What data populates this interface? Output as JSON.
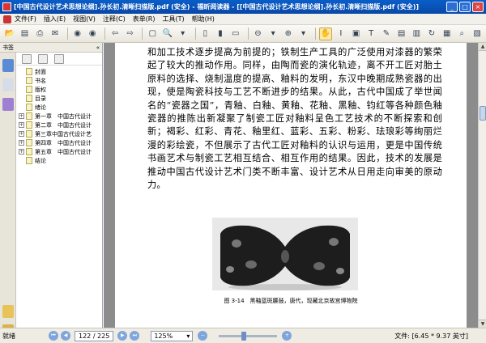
{
  "window": {
    "title": "[中国古代设计艺术思想论纲].孙长初.清晰扫描版.pdf (安全) - 福昕阅读器 - [[中国古代设计艺术思想论纲].孙长初.清晰扫描版.pdf (安全)]",
    "buttons": [
      "minimize",
      "maximize",
      "close"
    ]
  },
  "menu": [
    "文件(F)",
    "插入(E)",
    "视图(V)",
    "注释(C)",
    "表单(R)",
    "工具(T)",
    "帮助(H)"
  ],
  "sidebar": {
    "title": "书签",
    "collapse": "«",
    "bookmarks": [
      {
        "label": "封面",
        "expandable": false
      },
      {
        "label": "书名",
        "expandable": false
      },
      {
        "label": "版权",
        "expandable": false
      },
      {
        "label": "目录",
        "expandable": false
      },
      {
        "label": "绪论",
        "expandable": false
      },
      {
        "label": "第一章　中国古代设计",
        "expandable": true
      },
      {
        "label": "第二章　中国古代设计",
        "expandable": true
      },
      {
        "label": "第三章中国古代设计艺",
        "expandable": true
      },
      {
        "label": "第四章　中国古代设计",
        "expandable": true
      },
      {
        "label": "第五章　中国古代设计",
        "expandable": true
      },
      {
        "label": "结论",
        "expandable": false
      }
    ]
  },
  "document": {
    "paragraph": "和加工技术逐步提高为前提的；铁制生产工具的广泛使用对漆器的繁荣起了较大的推动作用。同样，由陶而瓷的演化轨迹，离不开工匠对胎土原料的选择、烧制温度的提高、釉料的发明，东汉中晚期成熟瓷器的出现，使是陶瓷科技与工艺不断进步的结果。从此，古代中国成了举世闻名的“瓷器之国”，青釉、白釉、黄釉、花釉、黑釉、钧红等各种颜色釉瓷器的推陈出新凝聚了制瓷工匠对釉料呈色工艺技术的不断探索和创新；褐彩、红彩、青花、釉里红、蓝彩、五彩、粉彩、珐琅彩等绚丽烂漫的彩绘瓷，不但展示了古代工匠对釉料的认识与运用，更是中国传统书画艺术与制瓷工艺相互结合、相互作用的结果。因此，技术的发展是推动中国古代设计艺术门类不断丰富、设计艺术从日用走向审美的原动力。",
    "caption": "图 3-14　黑釉蓝斑腰鼓，唐代，现藏北京故宫博物院"
  },
  "status": {
    "ready": "就绪",
    "page_display": "122 / 225",
    "zoom": "125%",
    "doc_size": "文件: [6.45 * 9.37 英寸]"
  }
}
